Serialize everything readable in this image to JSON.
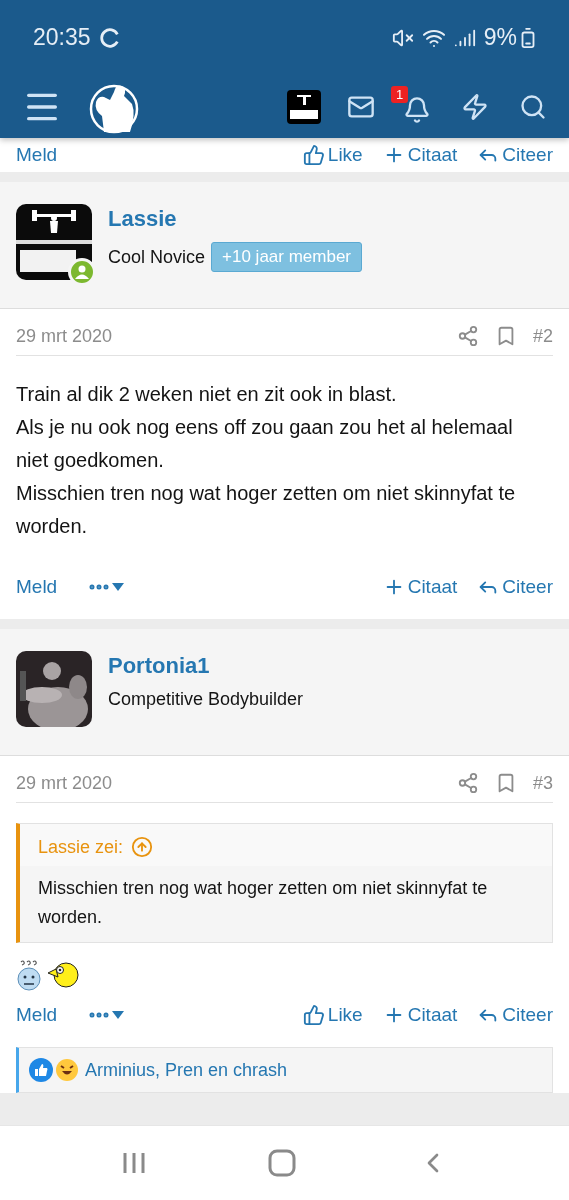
{
  "status_bar": {
    "time": "20:35",
    "battery": "9%"
  },
  "header": {
    "notification_count": "1"
  },
  "previous_post_actions": {
    "report": "Meld",
    "like": "Like",
    "quote": "Citaat",
    "reply": "Citeer"
  },
  "posts": [
    {
      "username": "Lassie",
      "user_title": "Cool Novice",
      "badge": "+10 jaar member",
      "online": true,
      "date": "29 mrt 2020",
      "number": "#2",
      "body": [
        "Train al dik 2 weken niet en zit ook in blast.",
        "Als je nu ook nog eens off zou gaan zou het al helemaal niet goedkomen.",
        "Misschien tren nog wat hoger zetten om niet skinnyfat te worden."
      ],
      "actions": {
        "report": "Meld",
        "quote": "Citaat",
        "reply": "Citeer"
      }
    },
    {
      "username": "Portonia1",
      "user_title": "Competitive Bodybuilder",
      "online": false,
      "date": "29 mrt 2020",
      "number": "#3",
      "quote": {
        "author": "Lassie zei:",
        "text": "Misschien tren nog wat hoger zetten om niet skinnyfat te worden."
      },
      "smilies": true,
      "actions": {
        "report": "Meld",
        "like": "Like",
        "quote": "Citaat",
        "reply": "Citeer"
      },
      "reactions": "Arminius, Pren en chrash"
    }
  ]
}
